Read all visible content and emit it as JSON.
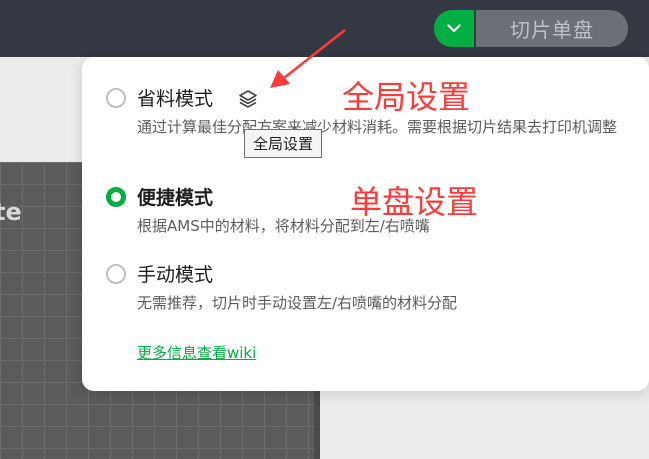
{
  "header": {
    "slice_button_label": "切片单盘",
    "toggle_icon": "chevron-down-icon"
  },
  "background": {
    "plate_label": "te"
  },
  "popup": {
    "modes": [
      {
        "title": "省料模式",
        "description": "通过计算最佳分配方案来减少材料消耗。需要根据切片结果去打印机调整",
        "selected": false,
        "icon": "layers-icon"
      },
      {
        "title": "便捷模式",
        "description": "根据AMS中的材料，将材料分配到左/右喷嘴",
        "selected": true
      },
      {
        "title": "手动模式",
        "description": "无需推荐，切片时手动设置左/右喷嘴的材料分配",
        "selected": false
      }
    ],
    "tooltip": "全局设置",
    "wiki_link": "更多信息查看wiki"
  },
  "annotations": {
    "global_setting": "全局设置",
    "single_plate_setting": "单盘设置",
    "color": "#ff3a3a"
  },
  "colors": {
    "accent": "#00ae42",
    "topbar": "#333842"
  }
}
